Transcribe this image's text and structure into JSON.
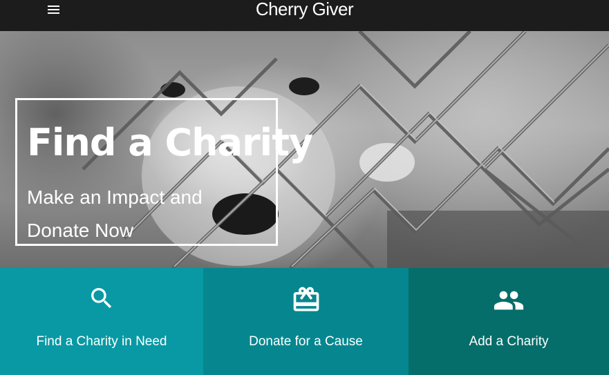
{
  "header": {
    "menu_icon": "menu-icon",
    "brand": "Cherry Giver"
  },
  "hero": {
    "title": "Find a Charity",
    "subtitle": "Make an Impact and Donate Now"
  },
  "actions": [
    {
      "label": "Find a Charity in Need",
      "icon": "search-icon",
      "color": "#0899a4"
    },
    {
      "label": "Donate for a Cause",
      "icon": "gift-card-icon",
      "color": "#06878f"
    },
    {
      "label": "Add a Charity",
      "icon": "people-icon",
      "color": "#056e6a"
    }
  ],
  "colors": {
    "topbar": "#1c1c1c",
    "text": "#ffffff"
  }
}
